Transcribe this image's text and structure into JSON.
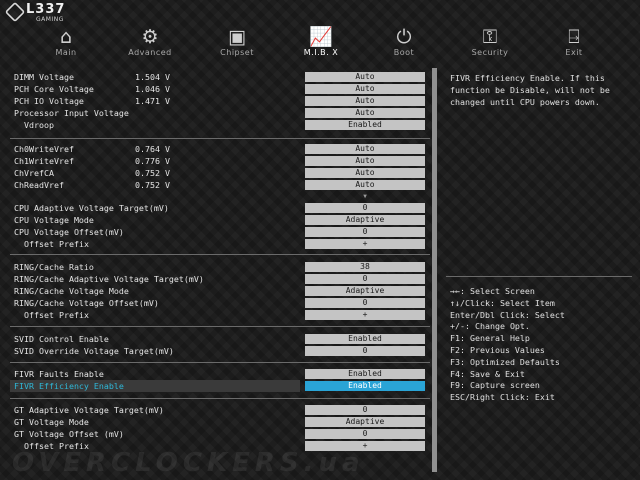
{
  "brand": {
    "name": "L337",
    "sub": "GAMING"
  },
  "tabs": [
    {
      "label": "Main",
      "icon": "home-icon",
      "glyph": "⌂"
    },
    {
      "label": "Advanced",
      "icon": "advanced-icon",
      "glyph": "⚙"
    },
    {
      "label": "Chipset",
      "icon": "chipset-icon",
      "glyph": "▣"
    },
    {
      "label": "M.I.B. X",
      "icon": "chart-icon",
      "glyph": "📈"
    },
    {
      "label": "Boot",
      "icon": "power-icon",
      "glyph": "⏻"
    },
    {
      "label": "Security",
      "icon": "key-icon",
      "glyph": "⚿"
    },
    {
      "label": "Exit",
      "icon": "exit-icon",
      "glyph": "⍈"
    }
  ],
  "settings": [
    {
      "label": "DIMM Voltage",
      "value": "1.504 V",
      "option": "Auto"
    },
    {
      "label": "PCH Core Voltage",
      "value": "1.046 V",
      "option": "Auto"
    },
    {
      "label": "PCH IO Voltage",
      "value": "1.471 V",
      "option": "Auto"
    },
    {
      "label": "Processor Input Voltage",
      "value": "",
      "option": "Auto"
    },
    {
      "label": "Vdroop",
      "value": "",
      "option": "Enabled"
    },
    {
      "label": "Ch0WriteVref",
      "value": "0.764 V",
      "option": "Auto"
    },
    {
      "label": "Ch1WriteVref",
      "value": "0.776 V",
      "option": "Auto"
    },
    {
      "label": "ChVrefCA",
      "value": "0.752 V",
      "option": "Auto"
    },
    {
      "label": "ChReadVref",
      "value": "0.752 V",
      "option": "Auto"
    },
    {
      "label": "",
      "value": "",
      "option": "▼"
    },
    {
      "label": "CPU Adaptive Voltage Target(mV)",
      "value": "",
      "option": "0"
    },
    {
      "label": "CPU Voltage Mode",
      "value": "",
      "option": "Adaptive"
    },
    {
      "label": "CPU Voltage Offset(mV)",
      "value": "",
      "option": "0"
    },
    {
      "label": "Offset Prefix",
      "value": "",
      "option": "+"
    },
    {
      "label": "RING/Cache Ratio",
      "value": "",
      "option": "38"
    },
    {
      "label": "RING/Cache Adaptive Voltage Target(mV)",
      "value": "",
      "option": "0"
    },
    {
      "label": "RING/Cache Voltage Mode",
      "value": "",
      "option": "Adaptive"
    },
    {
      "label": "RING/Cache Voltage Offset(mV)",
      "value": "",
      "option": "0"
    },
    {
      "label": "Offset Prefix",
      "value": "",
      "option": "+"
    },
    {
      "label": "SVID Control Enable",
      "value": "",
      "option": "Enabled"
    },
    {
      "label": "SVID Override Voltage Target(mV)",
      "value": "",
      "option": "0"
    },
    {
      "label": "FIVR Faults Enable",
      "value": "",
      "option": "Enabled"
    },
    {
      "label": "FIVR Efficiency Enable",
      "value": "",
      "option": "Enabled"
    },
    {
      "label": "GT Adaptive Voltage Target(mV)",
      "value": "",
      "option": "0"
    },
    {
      "label": "GT Voltage Mode",
      "value": "",
      "option": "Adaptive"
    },
    {
      "label": "GT Voltage Offset (mV)",
      "value": "",
      "option": "0"
    },
    {
      "label": "Offset Prefix",
      "value": "",
      "option": "+"
    }
  ],
  "help_text": "FIVR Efficiency Enable. If this function be Disable, will not be changed until CPU powers down.",
  "keys": [
    "→←: Select Screen",
    "↑↓/Click: Select Item",
    "Enter/Dbl Click: Select",
    "+/-: Change Opt.",
    "F1: General Help",
    "F2: Previous Values",
    "F3: Optimized Defaults",
    "F4: Save & Exit",
    "F9: Capture screen",
    "ESC/Right Click: Exit"
  ],
  "watermark": "OVERCLOCKERS.ua",
  "colors": {
    "accent": "#2aa4d6",
    "selected_label": "#2fb8d8",
    "option_box": "#c4c4c4",
    "active_tab_icon": "#ffb400"
  }
}
